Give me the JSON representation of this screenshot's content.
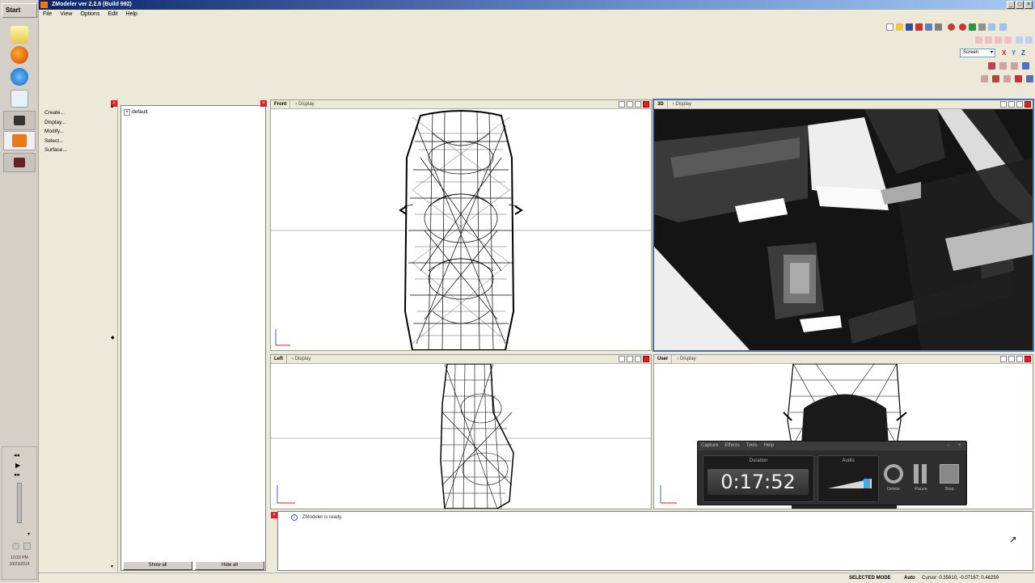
{
  "taskbar": {
    "start_label": "Start",
    "clock_time": "10:23 PM",
    "clock_date": "10/23/2014"
  },
  "window": {
    "title": "ZModeler ver 2.2.6 (Build 992)"
  },
  "menu": [
    "File",
    "View",
    "Options",
    "Edit",
    "Help"
  ],
  "screen_select": "Screen",
  "command_panel": {
    "items": [
      "Create...",
      "Display...",
      "Modify...",
      "Select...",
      "Surface..."
    ]
  },
  "tree": {
    "root": "default",
    "show_all": "Show all",
    "hide_all": "Hide all"
  },
  "viewports": {
    "front": {
      "name": "Front",
      "display": "Display"
    },
    "threed": {
      "name": "3D",
      "display": "Display"
    },
    "left": {
      "name": "Left",
      "display": "Display"
    },
    "user": {
      "name": "User",
      "display": "Display"
    }
  },
  "log": {
    "message": "ZModeler is ready."
  },
  "status": {
    "mode": "SELECTED MODE",
    "auto": "Auto",
    "cursor": "Cursor: 0.35610; -0.07167; 0.46259"
  },
  "recorder": {
    "menu": [
      "Capture",
      "Effects",
      "Tools",
      "Help"
    ],
    "duration_label": "Duration",
    "duration": "0:17:52",
    "audio_label": "Audio",
    "delete_label": "Delete",
    "pause_label": "Pause",
    "stop_label": "Stop"
  },
  "colors": {
    "title_start": "#0a246a",
    "recorder_bg": "#2e2e2e",
    "close": "#e02020"
  }
}
